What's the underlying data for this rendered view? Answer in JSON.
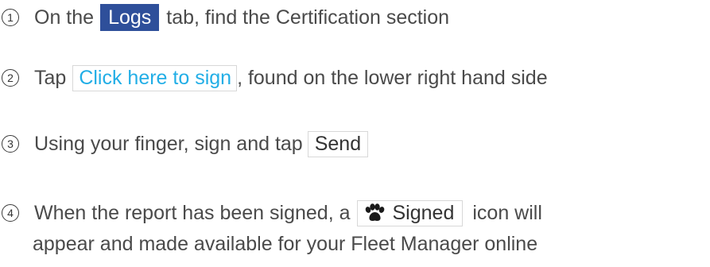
{
  "steps": [
    {
      "number": "1",
      "before": "On the",
      "badge": "Logs",
      "after": "tab, find the Certification section"
    },
    {
      "number": "2",
      "before": "Tap",
      "button": "Click here to sign",
      "after": ", found on the lower right hand side"
    },
    {
      "number": "3",
      "before": "Using your finger, sign and tap",
      "button": "Send"
    },
    {
      "number": "4",
      "before": "When the report has been signed, a",
      "badge_icon": "paw-icon",
      "badge": "Signed",
      "after": "icon will",
      "line2": "appear and made available for your Fleet Manager online"
    }
  ],
  "colors": {
    "text": "#4a4a4a",
    "logs_badge_bg": "#2e4f9a",
    "link_blue": "#22aee6",
    "box_border": "#d8d8d8"
  }
}
